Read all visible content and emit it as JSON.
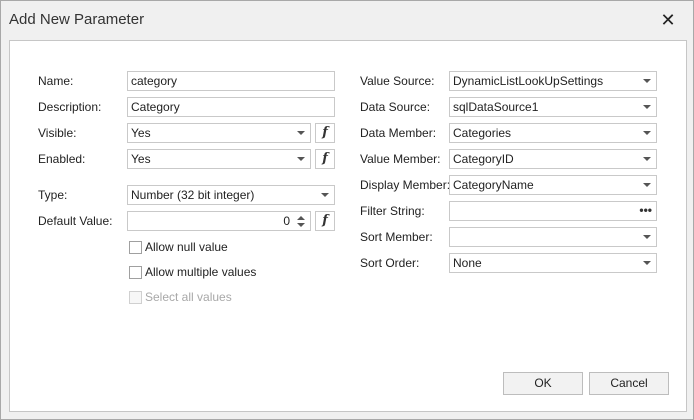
{
  "window": {
    "title": "Add New Parameter",
    "close_glyph": "✕"
  },
  "left": {
    "name": {
      "label": "Name:",
      "value": "category"
    },
    "description": {
      "label": "Description:",
      "value": "Category"
    },
    "visible": {
      "label": "Visible:",
      "value": "Yes"
    },
    "enabled": {
      "label": "Enabled:",
      "value": "Yes"
    },
    "type": {
      "label": "Type:",
      "value": "Number (32 bit integer)"
    },
    "default_value": {
      "label": "Default Value:",
      "value": "0"
    },
    "expression_glyph": "f",
    "checkboxes": {
      "allow_null": {
        "label": "Allow null value",
        "checked": false,
        "enabled": true
      },
      "allow_multiple": {
        "label": "Allow multiple values",
        "checked": false,
        "enabled": true
      },
      "select_all": {
        "label": "Select all values",
        "checked": false,
        "enabled": false
      }
    }
  },
  "right": {
    "value_source": {
      "label": "Value Source:",
      "value": "DynamicListLookUpSettings"
    },
    "data_source": {
      "label": "Data Source:",
      "value": "sqlDataSource1"
    },
    "data_member": {
      "label": "Data Member:",
      "value": "Categories"
    },
    "value_member": {
      "label": "Value Member:",
      "value": "CategoryID"
    },
    "display_member": {
      "label": "Display Member:",
      "value": "CategoryName"
    },
    "filter_string": {
      "label": "Filter String:",
      "value": "",
      "ellipsis": "•••"
    },
    "sort_member": {
      "label": "Sort Member:",
      "value": ""
    },
    "sort_order": {
      "label": "Sort Order:",
      "value": "None"
    }
  },
  "buttons": {
    "ok": "OK",
    "cancel": "Cancel"
  }
}
